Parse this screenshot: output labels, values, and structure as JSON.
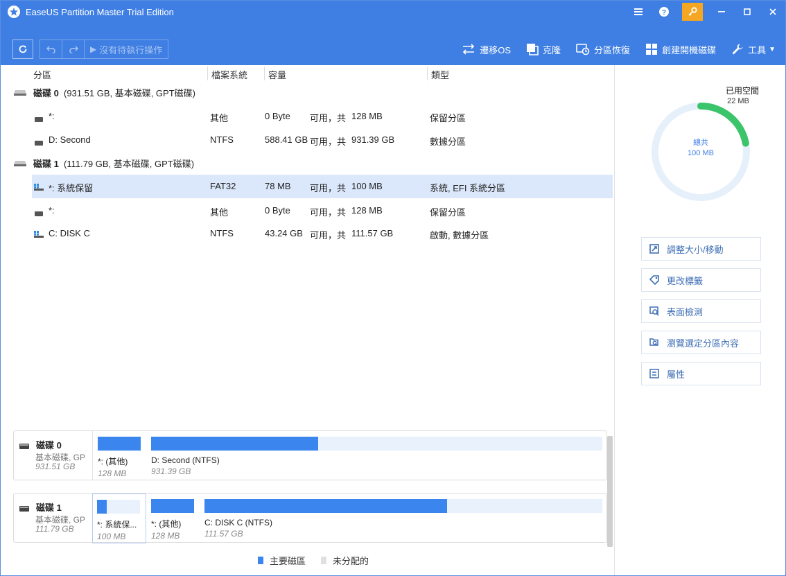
{
  "window": {
    "title": "EaseUS Partition Master Trial Edition",
    "controls": {
      "menu": "☰",
      "help": "?",
      "key": "key-icon",
      "minimize": "—",
      "maximize": "□",
      "close": "✕"
    }
  },
  "toolbar": {
    "pending_label": "沒有待執行操作",
    "actions": [
      {
        "label": "遷移OS",
        "icon": "migrate-os-icon"
      },
      {
        "label": "克隆",
        "icon": "clone-icon"
      },
      {
        "label": "分區恢復",
        "icon": "partition-recovery-icon"
      },
      {
        "label": "創建開機磁碟",
        "icon": "windows-icon"
      },
      {
        "label": "工具",
        "icon": "wrench-icon"
      }
    ]
  },
  "list": {
    "headers": {
      "partition": "分區",
      "filesystem": "檔案系統",
      "capacity": "容量",
      "type": "類型"
    },
    "disks": [
      {
        "name": "磁碟 0",
        "detail": "(931.51 GB, 基本磁碟, GPT磁碟)",
        "partitions": [
          {
            "name": "*:",
            "fs": "其他",
            "used": "0 Byte",
            "free": "可用，共",
            "total": "128 MB",
            "type": "保留分區"
          },
          {
            "name": "D: Second",
            "fs": "NTFS",
            "used": "588.41 GB",
            "free": "可用，共",
            "total": "931.39 GB",
            "type": "數據分區"
          }
        ]
      },
      {
        "name": "磁碟 1",
        "detail": "(111.79 GB, 基本磁碟, GPT磁碟)",
        "partitions": [
          {
            "name": "*: 系統保留",
            "fs": "FAT32",
            "used": "78 MB",
            "free": "可用，共",
            "total": "100 MB",
            "type": "系統, EFI 系統分區"
          },
          {
            "name": "*:",
            "fs": "其他",
            "used": "0 Byte",
            "free": "可用，共",
            "total": "128 MB",
            "type": "保留分區"
          },
          {
            "name": "C: DISK C",
            "fs": "NTFS",
            "used": "43.24 GB",
            "free": "可用，共",
            "total": "111.57 GB",
            "type": "啟動, 數據分區"
          }
        ]
      }
    ]
  },
  "usage": {
    "used_label": "已用空間",
    "used_value": "22 MB",
    "total_label": "總共",
    "total_value": "100 MB",
    "used_fraction": 0.22,
    "colors": {
      "used": "#3cc46a",
      "free": "#e6f0fb"
    }
  },
  "operations": [
    {
      "label": "調整大小/移動",
      "icon": "resize-icon"
    },
    {
      "label": "更改標籤",
      "icon": "tag-icon"
    },
    {
      "label": "表面檢測",
      "icon": "surface-test-icon"
    },
    {
      "label": "瀏覽選定分區內容",
      "icon": "browse-icon"
    },
    {
      "label": "屬性",
      "icon": "properties-icon"
    }
  ],
  "diskmap": [
    {
      "name": "磁碟 0",
      "type": "基本磁碟, GPT",
      "size": "931.51 GB",
      "parts": [
        {
          "label": "*: (其他)",
          "size": "128 MB",
          "fill": 1.0
        },
        {
          "label": "D: Second (NTFS)",
          "size": "931.39 GB",
          "fill": 0.37
        }
      ]
    },
    {
      "name": "磁碟 1",
      "type": "基本磁碟, GPT",
      "size": "111.79 GB",
      "parts": [
        {
          "label": "*: 系統保...",
          "size": "100 MB",
          "fill": 0.22
        },
        {
          "label": "*: (其他)",
          "size": "128 MB",
          "fill": 1.0
        },
        {
          "label": "C: DISK C (NTFS)",
          "size": "111.57 GB",
          "fill": 0.61
        }
      ]
    }
  ],
  "legend": {
    "primary": "主要磁區",
    "unallocated": "未分配的",
    "primary_color": "#3b86ee",
    "unallocated_color": "#e0e0e0"
  }
}
